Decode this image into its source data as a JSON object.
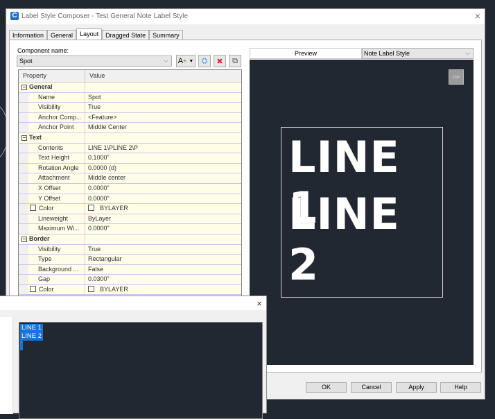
{
  "window": {
    "title": "Label Style Composer - Test General Note Label Style",
    "app_icon_glyph": "C",
    "close_glyph": "×"
  },
  "tabs": [
    {
      "label": "Information",
      "active": false
    },
    {
      "label": "General",
      "active": false
    },
    {
      "label": "Layout",
      "active": true
    },
    {
      "label": "Dragged State",
      "active": false
    },
    {
      "label": "Summary",
      "active": false
    }
  ],
  "component": {
    "label": "Component name:",
    "value": "Spot",
    "toolbar": [
      {
        "name": "create-text-component-icon",
        "glyph": "A₊ ▾"
      },
      {
        "name": "copy-component-icon",
        "glyph": "⛭"
      },
      {
        "name": "delete-component-icon",
        "glyph": "✖"
      },
      {
        "name": "component-draw-order-icon",
        "glyph": "⧉"
      }
    ]
  },
  "grid": {
    "headers": {
      "property": "Property",
      "value": "Value"
    },
    "categories": [
      {
        "name": "General",
        "expander": "−",
        "rows": [
          {
            "property": "Name",
            "value": "Spot"
          },
          {
            "property": "Visibility",
            "value": "True"
          },
          {
            "property": "Anchor Comp...",
            "value": "<Feature>"
          },
          {
            "property": "Anchor Point",
            "value": "Middle Center"
          }
        ]
      },
      {
        "name": "Text",
        "expander": "−",
        "rows": [
          {
            "property": "Contents",
            "value": "LINE 1\\PLINE 2\\P"
          },
          {
            "property": "Text Height",
            "value": "0.1000\""
          },
          {
            "property": "Rotation Angle",
            "value": "0.0000 (d)"
          },
          {
            "property": "Attachment",
            "value": "Middle center"
          },
          {
            "property": "X Offset",
            "value": "0.0000\""
          },
          {
            "property": "Y Offset",
            "value": "0.0000\""
          },
          {
            "property": "Color",
            "value": "BYLAYER",
            "checkbox": true
          },
          {
            "property": "Lineweight",
            "value": "ByLayer"
          },
          {
            "property": "Maximum Wi...",
            "value": "0.0000\""
          }
        ]
      },
      {
        "name": "Border",
        "expander": "−",
        "rows": [
          {
            "property": "Visibility",
            "value": "True"
          },
          {
            "property": "Type",
            "value": "Rectangular"
          },
          {
            "property": "Background ...",
            "value": "False"
          },
          {
            "property": "Gap",
            "value": "0.0300\""
          },
          {
            "property": "Color",
            "value": "BYLAYER",
            "checkbox": true
          }
        ]
      }
    ]
  },
  "preview": {
    "tab_label": "Preview",
    "style_select": "Note Label Style",
    "top_button": "TOP",
    "lines": [
      "LINE 1",
      "LINE 2"
    ]
  },
  "buttons": {
    "ok": "OK",
    "cancel": "Cancel",
    "apply": "Apply",
    "help": "Help"
  },
  "text_editor": {
    "close_glyph": "×",
    "lines": [
      "LINE 1",
      "LINE 2"
    ]
  }
}
